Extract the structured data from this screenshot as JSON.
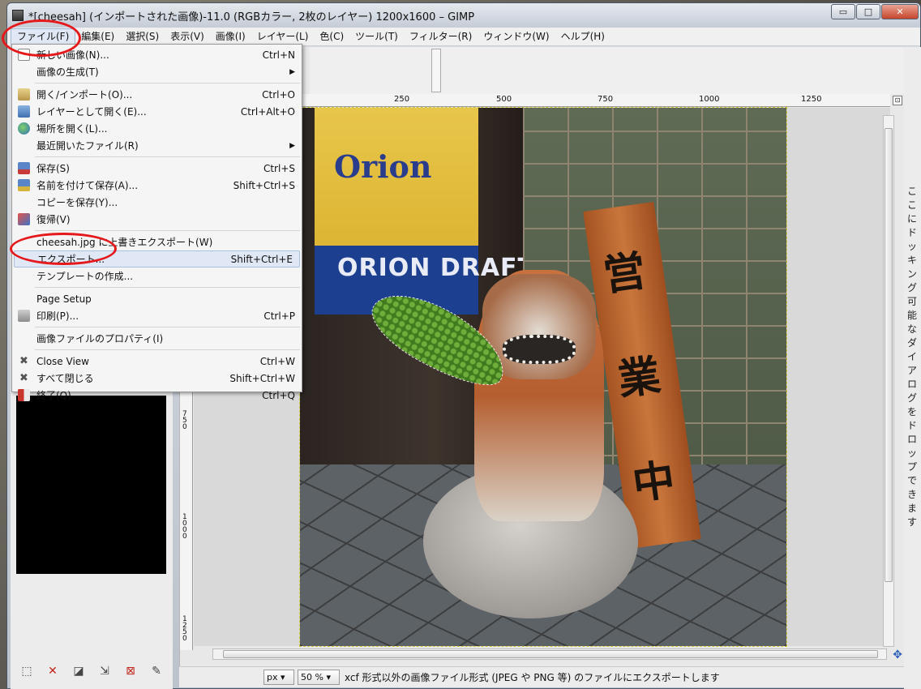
{
  "window": {
    "title": "*[cheesah] (インポートされた画像)-11.0 (RGBカラー, 2枚のレイヤー) 1200x1600 – GIMP",
    "minimize_label": "▭",
    "maximize_label": "□",
    "close_label": "✕"
  },
  "menubar": {
    "items": [
      "ファイル(F)",
      "編集(E)",
      "選択(S)",
      "表示(V)",
      "画像(I)",
      "レイヤー(L)",
      "色(C)",
      "ツール(T)",
      "フィルター(R)",
      "ウィンドウ(W)",
      "ヘルプ(H)"
    ]
  },
  "file_menu": {
    "items": [
      {
        "label": "新しい画像(N)...",
        "shortcut": "Ctrl+N",
        "icon": "new-image-icon"
      },
      {
        "label": "画像の生成(T)",
        "shortcut": "",
        "submenu": true
      },
      {
        "label": "開く/インポート(O)...",
        "shortcut": "Ctrl+O",
        "icon": "open-folder-icon"
      },
      {
        "label": "レイヤーとして開く(E)...",
        "shortcut": "Ctrl+Alt+O",
        "icon": "open-as-layer-icon"
      },
      {
        "label": "場所を開く(L)...",
        "shortcut": "",
        "icon": "globe-icon"
      },
      {
        "label": "最近開いたファイル(R)",
        "shortcut": "",
        "submenu": true
      },
      {
        "label": "保存(S)",
        "shortcut": "Ctrl+S",
        "icon": "save-icon"
      },
      {
        "label": "名前を付けて保存(A)...",
        "shortcut": "Shift+Ctrl+S",
        "icon": "save-as-icon"
      },
      {
        "label": "コピーを保存(Y)...",
        "shortcut": ""
      },
      {
        "label": "復帰(V)",
        "shortcut": "",
        "icon": "revert-icon"
      },
      {
        "label": "cheesah.jpg に上書きエクスポート(W)",
        "shortcut": ""
      },
      {
        "label": "エクスポート...",
        "shortcut": "Shift+Ctrl+E"
      },
      {
        "label": "テンプレートの作成...",
        "shortcut": ""
      },
      {
        "label": "Page Setup",
        "shortcut": ""
      },
      {
        "label": "印刷(P)...",
        "shortcut": "Ctrl+P",
        "icon": "print-icon"
      },
      {
        "label": "画像ファイルのプロパティ(I)",
        "shortcut": ""
      },
      {
        "label": "Close View",
        "shortcut": "Ctrl+W",
        "icon": "close-view-icon"
      },
      {
        "label": "すべて閉じる",
        "shortcut": "Shift+Ctrl+W",
        "icon": "close-all-icon"
      },
      {
        "label": "終了(Q)",
        "shortcut": "Ctrl+Q",
        "icon": "quit-icon"
      }
    ]
  },
  "ruler": {
    "h_ticks": [
      "250",
      "500",
      "750",
      "1000",
      "1250"
    ],
    "v_ticks": [
      "750",
      "1000",
      "1250"
    ]
  },
  "image": {
    "poster_brand": "Orion",
    "poster_tagline": "ORION DRAFT",
    "sign_chars": [
      "営",
      "業",
      "中"
    ]
  },
  "dock_hint": "ここにドッキング可能なダイアログをドロップできます",
  "statusbar": {
    "unit": "px",
    "zoom": "50 %",
    "message": "xcf 形式以外の画像ファイル形式 (JPEG や PNG 等) のファイルにエクスポートします"
  },
  "colors": {
    "annotation": "#e5191b",
    "menu_highlight": "#dfe8f4"
  }
}
